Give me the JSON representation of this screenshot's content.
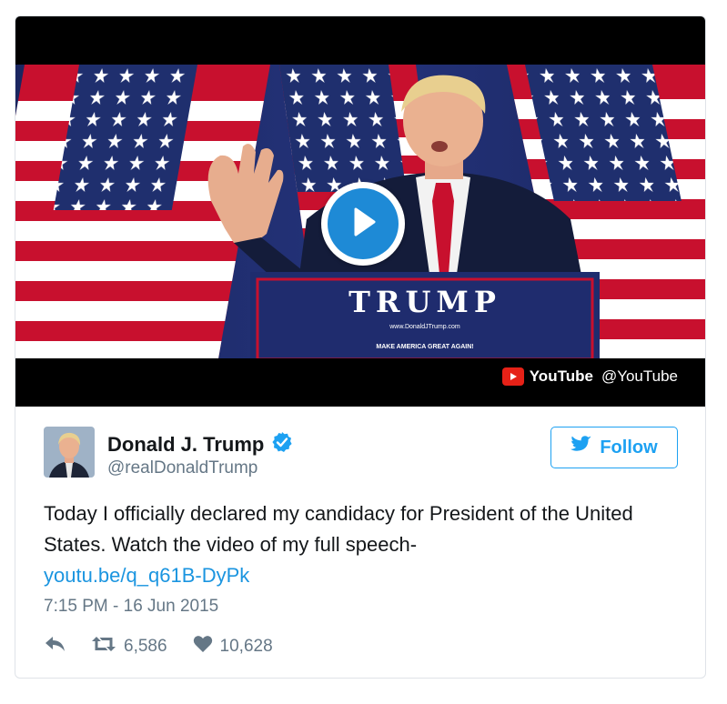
{
  "media": {
    "podium_text": "TRUMP",
    "podium_url": "www.DonaldJTrump.com",
    "podium_slogan": "MAKE AMERICA GREAT AGAIN!",
    "source_name": "YouTube",
    "source_handle": "@YouTube"
  },
  "author": {
    "name": "Donald J. Trump",
    "handle": "@realDonaldTrump",
    "verified": true
  },
  "follow_button": {
    "label": "Follow"
  },
  "tweet": {
    "text": "Today I officially declared my candidacy for President of the United States. Watch the video of my full speech-",
    "link": "youtu.be/q_q61B-DyPk",
    "timestamp": "7:15 PM - 16 Jun 2015"
  },
  "stats": {
    "retweets": "6,586",
    "likes": "10,628"
  },
  "colors": {
    "accent": "#1da1f2",
    "link": "#1b95e0",
    "play_button": "#1e8ad6",
    "youtube_red": "#e62117",
    "muted_text": "#657786"
  },
  "icons": {
    "play": "play-icon",
    "youtube": "youtube-logo-icon",
    "verified": "verified-badge-icon",
    "twitter": "twitter-bird-icon",
    "reply": "reply-icon",
    "retweet": "retweet-icon",
    "like": "heart-icon"
  }
}
